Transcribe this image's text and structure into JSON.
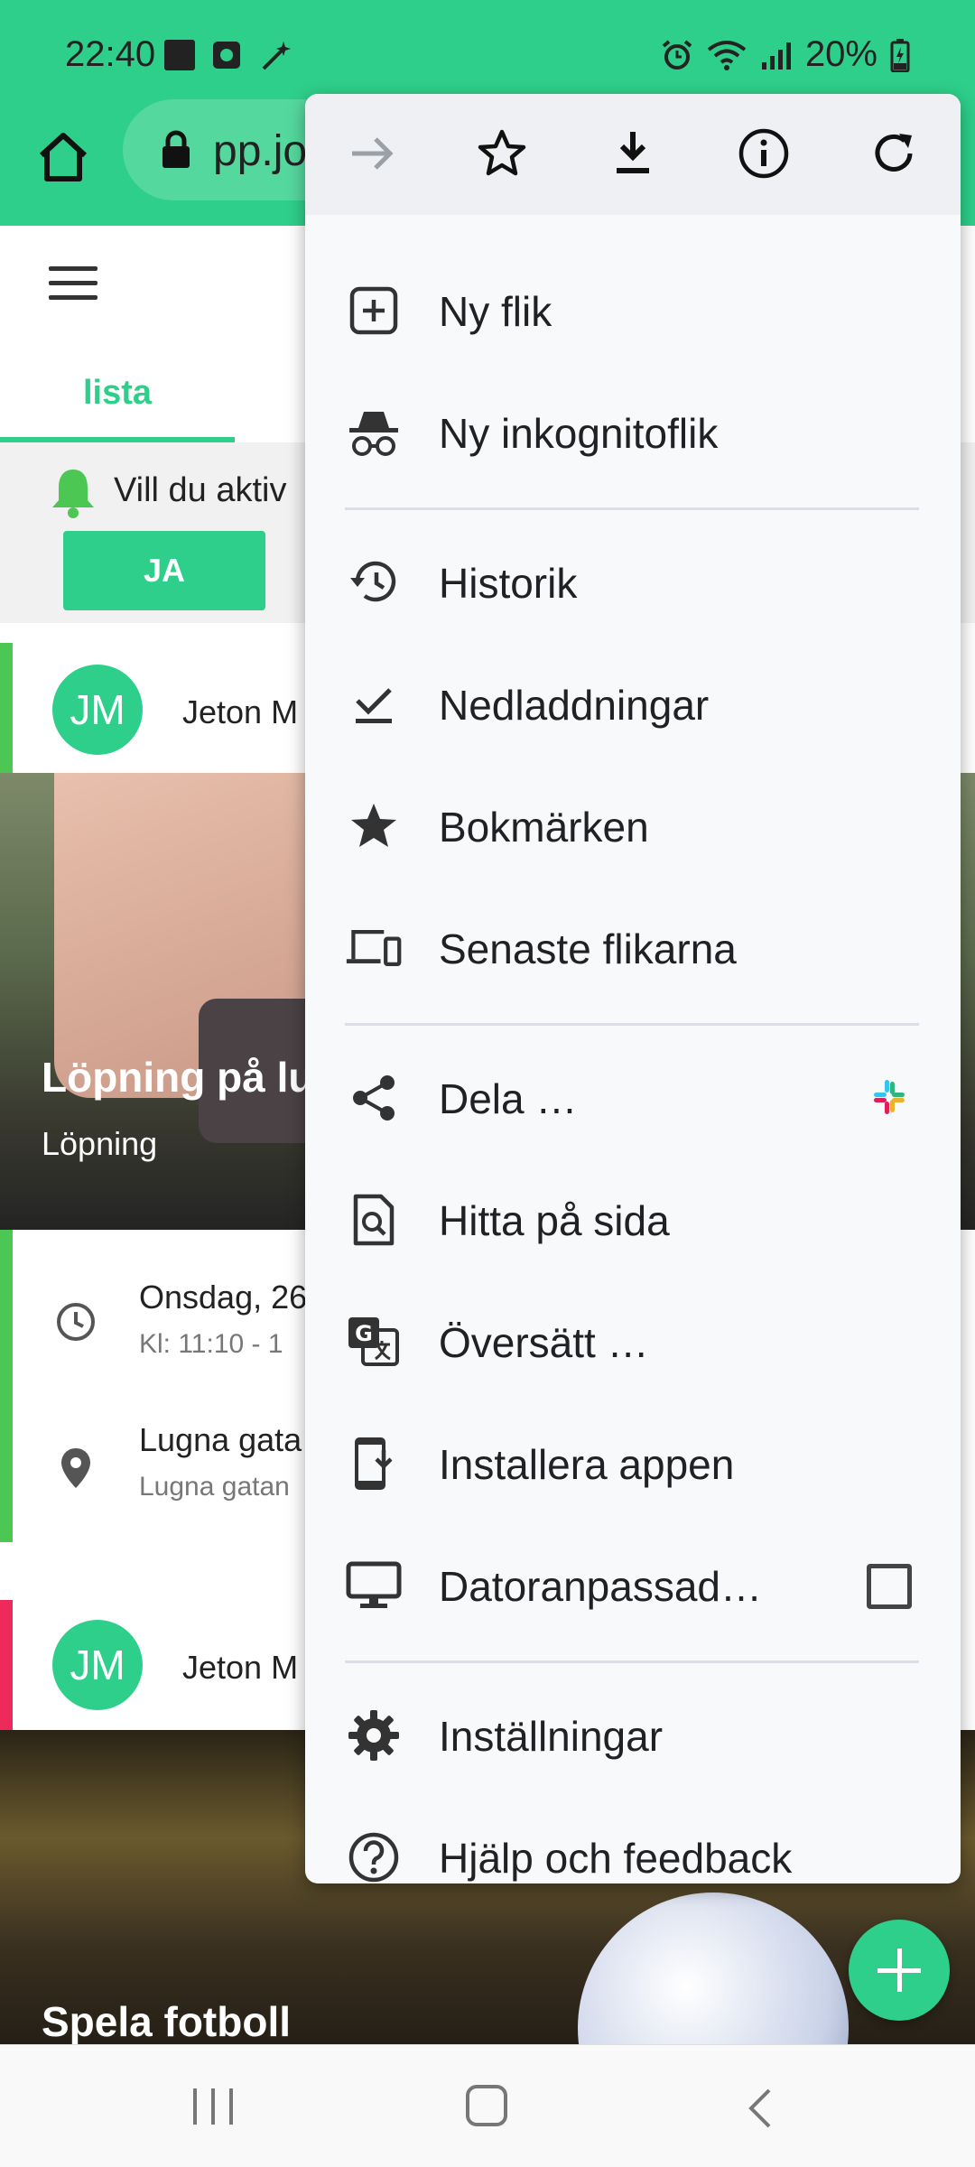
{
  "status_bar": {
    "time": "22:40",
    "battery": "20%"
  },
  "browser": {
    "url": "pp.jo"
  },
  "page": {
    "tabs": [
      {
        "label": "lista"
      }
    ],
    "notification": {
      "text": "Vill du aktiv",
      "button": "JA"
    },
    "cards": [
      {
        "avatar": "JM",
        "author": "Jeton M",
        "bar_color": "#4cc754",
        "title": "Löpning på lu",
        "category": "Löpning",
        "date": "Onsdag, 26",
        "time": "Kl: 11:10 - 1",
        "location": "Lugna gata",
        "location_sub": "Lugna gatan"
      },
      {
        "avatar": "JM",
        "author": "Jeton M",
        "bar_color": "#ee2a5a",
        "title": "Spela fotboll"
      }
    ]
  },
  "menu": {
    "top_actions": [
      "forward-icon",
      "bookmark-star-icon",
      "download-icon",
      "info-icon",
      "refresh-icon"
    ],
    "items": [
      {
        "label": "Ny flik",
        "icon": "new-tab-icon"
      },
      {
        "label": "Ny inkognitoflik",
        "icon": "incognito-icon"
      },
      {
        "label": "Historik",
        "icon": "history-icon"
      },
      {
        "label": "Nedladdningar",
        "icon": "downloads-icon"
      },
      {
        "label": "Bokmärken",
        "icon": "bookmarks-icon"
      },
      {
        "label": "Senaste flikarna",
        "icon": "recent-tabs-icon"
      },
      {
        "label": "Dela …",
        "icon": "share-icon"
      },
      {
        "label": "Hitta på sida",
        "icon": "find-in-page-icon"
      },
      {
        "label": "Översätt …",
        "icon": "translate-icon"
      },
      {
        "label": "Installera appen",
        "icon": "install-app-icon"
      },
      {
        "label": "Datoranpassad…",
        "icon": "desktop-icon",
        "checked": false
      },
      {
        "label": "Inställningar",
        "icon": "settings-icon"
      },
      {
        "label": "Hjälp och feedback",
        "icon": "help-icon"
      }
    ]
  },
  "colors": {
    "accent": "#2ecf8a",
    "menu_bg": "#f8f9fa"
  }
}
